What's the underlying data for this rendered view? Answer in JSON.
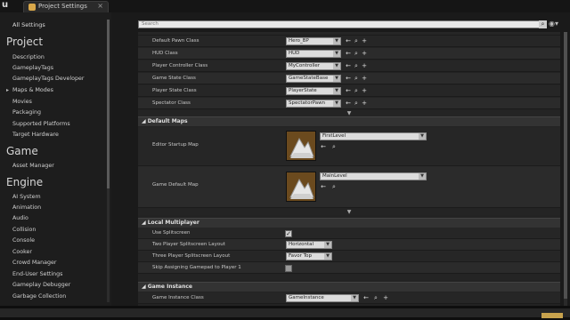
{
  "window": {
    "logo": "u",
    "tab_label": "Project Settings",
    "tab_close": "×"
  },
  "sidebar": {
    "all_settings": "All Settings",
    "sections": [
      {
        "title": "Project",
        "items": [
          "Description",
          "GameplayTags",
          "GameplayTags Developer",
          "Maps & Modes",
          "Movies",
          "Packaging",
          "Supported Platforms",
          "Target Hardware"
        ]
      },
      {
        "title": "Game",
        "items": [
          "Asset Manager"
        ]
      },
      {
        "title": "Engine",
        "items": [
          "AI System",
          "Animation",
          "Audio",
          "Collision",
          "Console",
          "Cooker",
          "Crowd Manager",
          "End-User Settings",
          "Gameplay Debugger",
          "Garbage Collection"
        ]
      }
    ],
    "active_item": "Maps & Modes"
  },
  "search": {
    "placeholder": "Search"
  },
  "default_modes": {
    "rows": [
      {
        "label": "Default Pawn Class",
        "value": "Hero_BP"
      },
      {
        "label": "HUD Class",
        "value": "HUD"
      },
      {
        "label": "Player Controller Class",
        "value": "MyController"
      },
      {
        "label": "Game State Class",
        "value": "GameStateBase"
      },
      {
        "label": "Player State Class",
        "value": "PlayerState"
      },
      {
        "label": "Spectator Class",
        "value": "SpectatorPawn"
      }
    ]
  },
  "default_maps": {
    "title": "Default Maps",
    "editor_startup_label": "Editor Startup Map",
    "editor_startup_value": "FirstLevel",
    "game_default_label": "Game Default Map",
    "game_default_value": "MainLevel"
  },
  "local_multiplayer": {
    "title": "Local Multiplayer",
    "use_splitscreen_label": "Use Splitscreen",
    "use_splitscreen_checked": true,
    "two_player_label": "Two Player Splitscreen Layout",
    "two_player_value": "Horizontal",
    "three_player_label": "Three Player Splitscreen Layout",
    "three_player_value": "Favor Top",
    "skip_gamepad_label": "Skip Assigning Gamepad to Player 1",
    "skip_gamepad_checked": false
  },
  "game_instance": {
    "title": "Game Instance",
    "label": "Game Instance Class",
    "value": "GameInstance"
  },
  "colors": {
    "background": "#1a1a1a",
    "category": "#333333",
    "thumbnail": "#6b4a1e",
    "badge": "#c7a24d"
  }
}
